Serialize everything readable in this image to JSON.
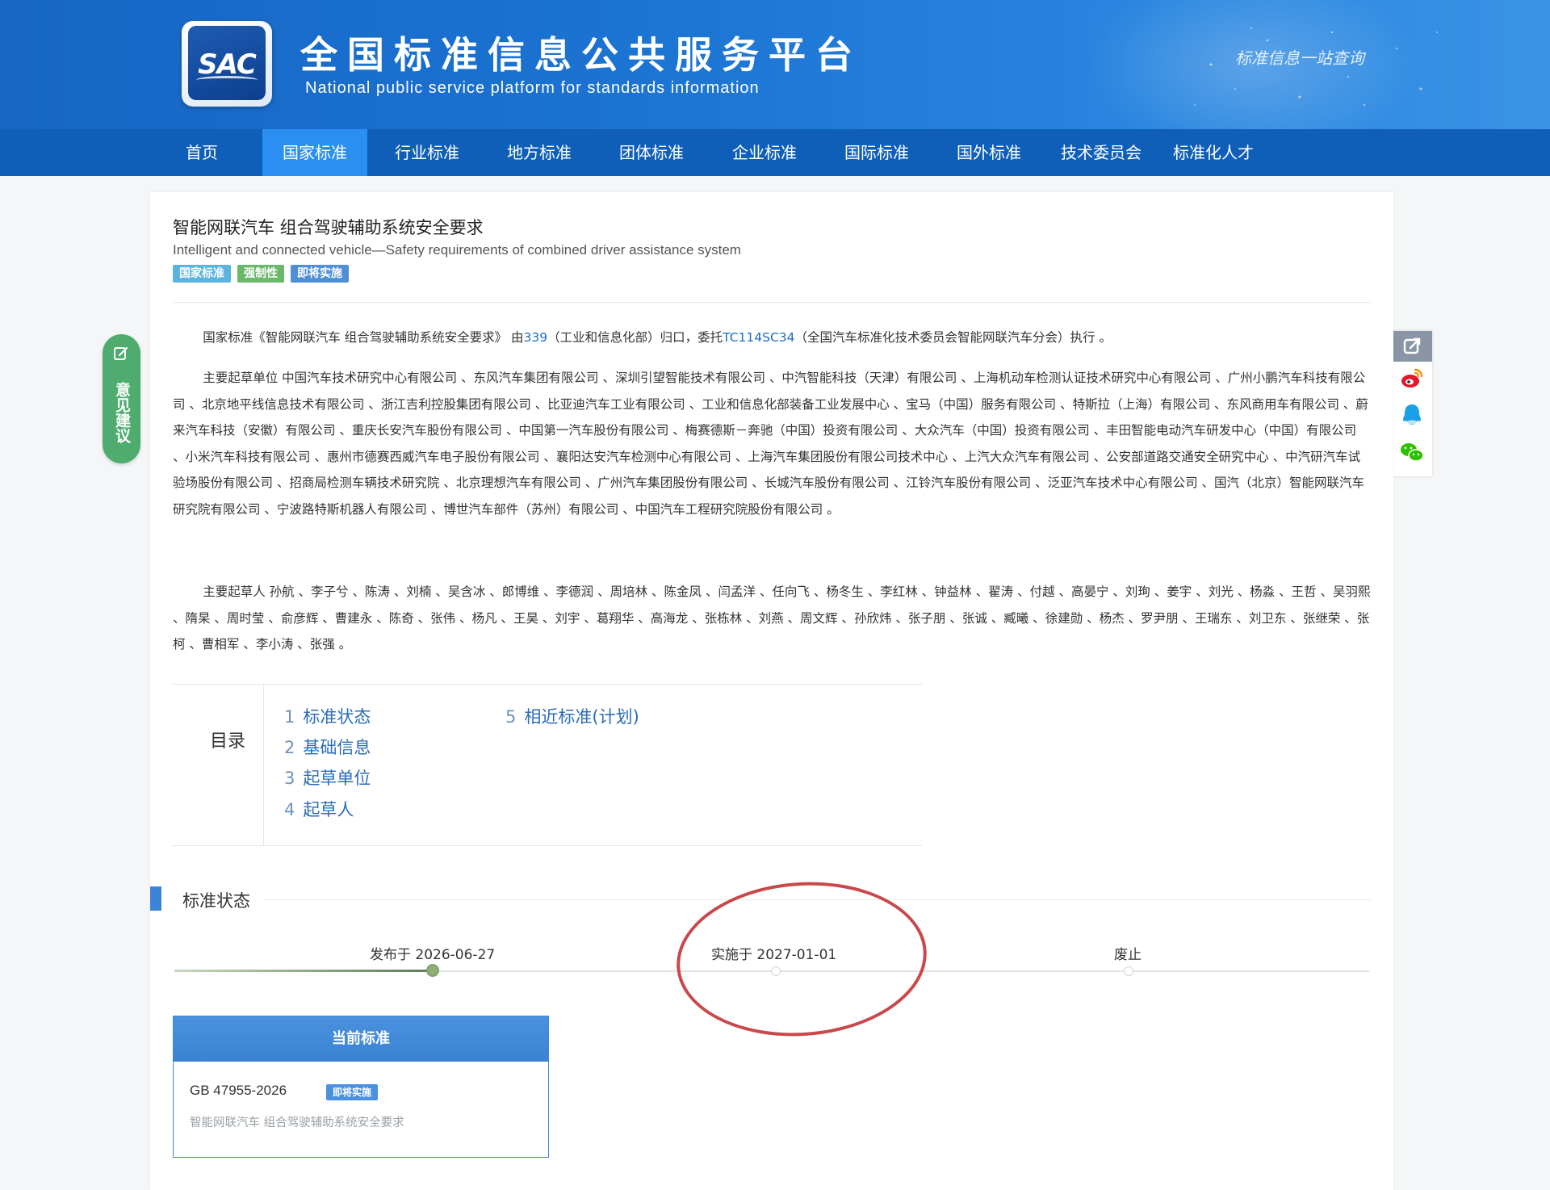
{
  "header": {
    "logo_text": "SAC",
    "title": "全国标准信息公共服务平台",
    "subtitle": "National public service platform  for standards information",
    "slogan": "标准信息一站查询"
  },
  "nav": {
    "items": [
      "首页",
      "国家标准",
      "行业标准",
      "地方标准",
      "团体标准",
      "企业标准",
      "国际标准",
      "国外标准",
      "技术委员会",
      "标准化人才"
    ],
    "active_index": 1
  },
  "standard": {
    "title": "智能网联汽车 组合驾驶辅助系统安全要求",
    "title_en": "Intelligent and connected vehicle—Safety requirements of combined driver assistance system",
    "badges": [
      {
        "label": "国家标准",
        "color": "#5bb4de"
      },
      {
        "label": "强制性",
        "color": "#6cb86a"
      },
      {
        "label": "即将实施",
        "color": "#4f8fd6"
      }
    ],
    "intro": {
      "prefix": "国家标准《智能网联汽车 组合驾驶辅助系统安全要求》 由",
      "dept_code": "339",
      "dept_text": "（工业和信息化部）归口，委托",
      "tc_code": "TC114SC34",
      "tc_text": "（全国汽车标准化技术委员会智能网联汽车分会）执行 。"
    },
    "drafting_units": "主要起草单位 中国汽车技术研究中心有限公司 、东风汽车集团有限公司 、深圳引望智能技术有限公司 、中汽智能科技（天津）有限公司 、上海机动车检测认证技术研究中心有限公司 、广州小鹏汽车科技有限公司 、北京地平线信息技术有限公司 、浙江吉利控股集团有限公司 、比亚迪汽车工业有限公司 、工业和信息化部装备工业发展中心 、宝马（中国）服务有限公司 、特斯拉（上海）有限公司 、东风商用车有限公司 、蔚来汽车科技（安徽）有限公司 、重庆长安汽车股份有限公司 、中国第一汽车股份有限公司 、梅赛德斯－奔驰（中国）投资有限公司 、大众汽车（中国）投资有限公司 、丰田智能电动汽车研发中心（中国）有限公司 、小米汽车科技有限公司 、惠州市德赛西威汽车电子股份有限公司 、襄阳达安汽车检测中心有限公司 、上海汽车集团股份有限公司技术中心 、上汽大众汽车有限公司 、公安部道路交通安全研究中心 、中汽研汽车试验场股份有限公司 、招商局检测车辆技术研究院 、北京理想汽车有限公司 、广州汽车集团股份有限公司 、长城汽车股份有限公司 、江铃汽车股份有限公司 、泛亚汽车技术中心有限公司 、国汽（北京）智能网联汽车研究院有限公司 、宁波路特斯机器人有限公司 、博世汽车部件（苏州）有限公司 、中国汽车工程研究院股份有限公司 。",
    "drafters": "主要起草人 孙航 、李子兮 、陈涛 、刘楠 、吴含冰 、郎博维 、李德润 、周培林 、陈金凤 、闫孟洋 、任向飞 、杨冬生 、李红林 、钟益林 、翟涛 、付越 、高晏宁 、刘珣 、姜宇 、刘光 、杨淼 、王哲 、吴羽熙 、隋杲 、周时莹 、俞彦辉 、曹建永 、陈奇 、张伟 、杨凡 、王昊 、刘宇 、葛翔华 、高海龙 、张栋林 、刘燕 、周文辉 、孙欣炜 、张子朋 、张诚 、臧曦 、徐建勋 、杨杰 、罗尹朋 、王瑞东 、刘卫东 、张继荣 、张柯 、曹相军 、李小涛 、张强 。"
  },
  "toc": {
    "label": "目录",
    "items": [
      {
        "num": "1",
        "label": "标准状态"
      },
      {
        "num": "2",
        "label": "基础信息"
      },
      {
        "num": "3",
        "label": "起草单位"
      },
      {
        "num": "4",
        "label": "起草人"
      },
      {
        "num": "5",
        "label": "相近标准(计划)"
      }
    ]
  },
  "status": {
    "title": "标准状态",
    "steps": [
      {
        "label": "发布于 2026-06-27",
        "done": true
      },
      {
        "label": "实施于 2027-01-01",
        "done": false
      },
      {
        "label": "废止",
        "done": false
      }
    ]
  },
  "current_standard": {
    "header": "当前标准",
    "code": "GB 47955-2026",
    "badge": "即将实施",
    "name": "智能网联汽车 组合驾驶辅助系统安全要求"
  },
  "feedback": {
    "label": "意见建议"
  },
  "share_icons": [
    "share-icon",
    "weibo-icon",
    "qq-icon",
    "wechat-icon"
  ],
  "colors": {
    "header_blue": "#1b73d2",
    "nav_blue": "#0f5fb8",
    "nav_active": "#2a8ff0",
    "link": "#1f6ac2",
    "annotation_red": "#c9484a"
  }
}
